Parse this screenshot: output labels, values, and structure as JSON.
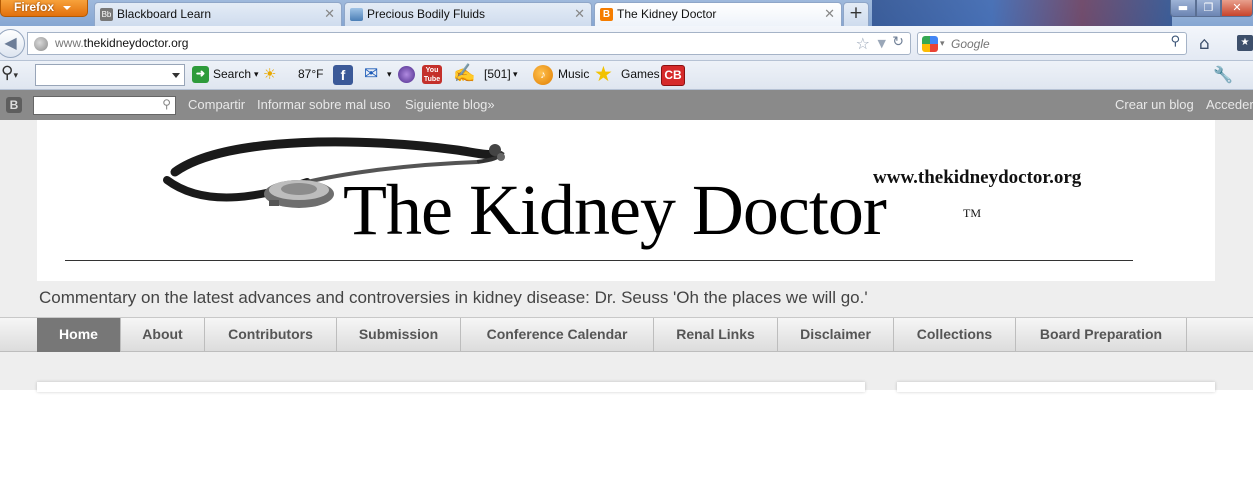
{
  "browser": {
    "app_button_label": "Firefox",
    "tabs": [
      {
        "title": "Blackboard Learn",
        "icon": "blackboard-favicon"
      },
      {
        "title": "Precious Bodily Fluids",
        "icon": "blog-favicon"
      },
      {
        "title": "The Kidney Doctor",
        "icon": "blogger-favicon"
      }
    ],
    "new_tab_label": "+",
    "url_prefix": "www.",
    "url_domain": "thekidneydoctor.org",
    "search_placeholder": "Google"
  },
  "addon_toolbar": {
    "search_label": "Search",
    "weather": "87°F",
    "mail_count": "[501]",
    "music_label": "Music",
    "games_label": "Games",
    "cb_badge": "CB",
    "youtube_badge": "You Tube"
  },
  "blogger_bar": {
    "logo": "B",
    "share": "Compartir",
    "report": "Informar sobre mal uso",
    "next_blog": "Siguiente blog»",
    "create_blog": "Crear un blog",
    "sign_in": "Acceder"
  },
  "blog": {
    "header_url": "www.thekidneydoctor.org",
    "header_title": "The Kidney Doctor",
    "header_tm": "TM",
    "description": "Commentary on the latest advances and controversies in kidney disease: Dr. Seuss 'Oh the places we will go.'",
    "nav_tabs": [
      {
        "label": "Home",
        "active": true
      },
      {
        "label": "About",
        "active": false
      },
      {
        "label": "Contributors",
        "active": false
      },
      {
        "label": "Submission",
        "active": false
      },
      {
        "label": "Conference Calendar",
        "active": false
      },
      {
        "label": "Renal Links",
        "active": false
      },
      {
        "label": "Disclaimer",
        "active": false
      },
      {
        "label": "Collections",
        "active": false
      },
      {
        "label": "Board Preparation",
        "active": false
      }
    ]
  },
  "colors": {
    "firefox_orange": "#e2700c",
    "blogger_bar": "#8a8a8a",
    "active_tab": "#777777",
    "page_background": "#eeeeee"
  }
}
